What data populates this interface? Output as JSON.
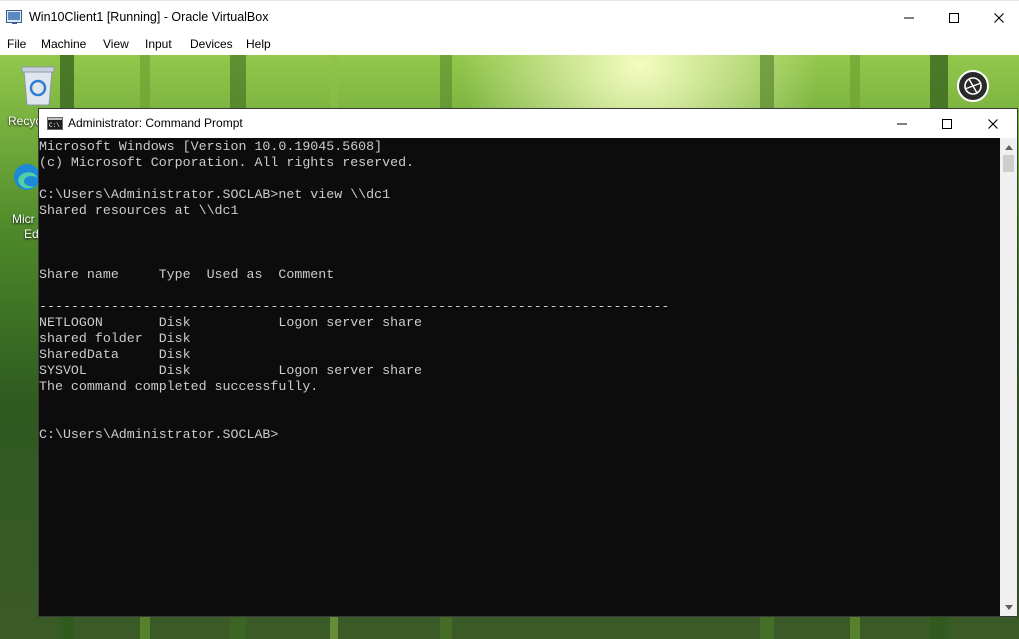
{
  "host_window": {
    "title": "Win10Client1 [Running] - Oracle VirtualBox",
    "menu": [
      "File",
      "Machine",
      "View",
      "Input",
      "Devices",
      "Help"
    ]
  },
  "desktop": {
    "icons": [
      {
        "name": "recycle-bin",
        "label": "Recyc"
      },
      {
        "name": "microsoft-edge",
        "label_lines": [
          "Micr",
          "Ed"
        ]
      }
    ]
  },
  "cmd_window": {
    "title": "Administrator: Command Prompt",
    "lines": [
      "Microsoft Windows [Version 10.0.19045.5608]",
      "(c) Microsoft Corporation. All rights reserved.",
      "",
      "C:\\Users\\Administrator.SOCLAB>net view \\\\dc1",
      "Shared resources at \\\\dc1",
      "",
      "",
      "",
      "Share name     Type  Used as  Comment",
      "",
      "-------------------------------------------------------------------------------",
      "NETLOGON       Disk           Logon server share",
      "shared folder  Disk",
      "SharedData     Disk",
      "SYSVOL         Disk           Logon server share",
      "The command completed successfully.",
      "",
      "",
      "C:\\Users\\Administrator.SOCLAB>"
    ]
  },
  "colors": {
    "console_bg": "#0c0c0c",
    "console_text": "#cccccc"
  }
}
